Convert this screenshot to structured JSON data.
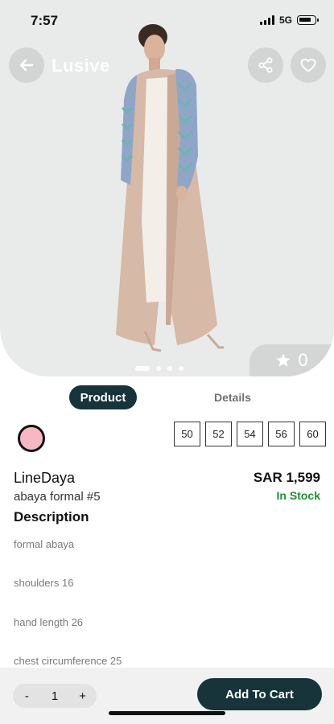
{
  "status": {
    "time": "7:57",
    "network": "5G"
  },
  "header": {
    "brand": "Lusive"
  },
  "rating": {
    "value": "0"
  },
  "tabs": {
    "product": "Product",
    "details": "Details"
  },
  "product": {
    "brand": "LineDaya",
    "name": "abaya formal #5",
    "price": "SAR 1,599",
    "stock": "In Stock",
    "color": "#f6b9c4",
    "sizes": [
      "50",
      "52",
      "54",
      "56",
      "60"
    ]
  },
  "description": {
    "heading": "Description",
    "lines": [
      "formal abaya",
      "shoulders 16",
      "hand length 26",
      "chest circumference 25"
    ]
  },
  "cart": {
    "qty_minus": "-",
    "quantity": "1",
    "qty_plus": "+",
    "add_label": "Add To Cart"
  },
  "colors": {
    "primary": "#16343a",
    "stock_green": "#1f8f2f",
    "hero_bg": "#e9ebea"
  }
}
